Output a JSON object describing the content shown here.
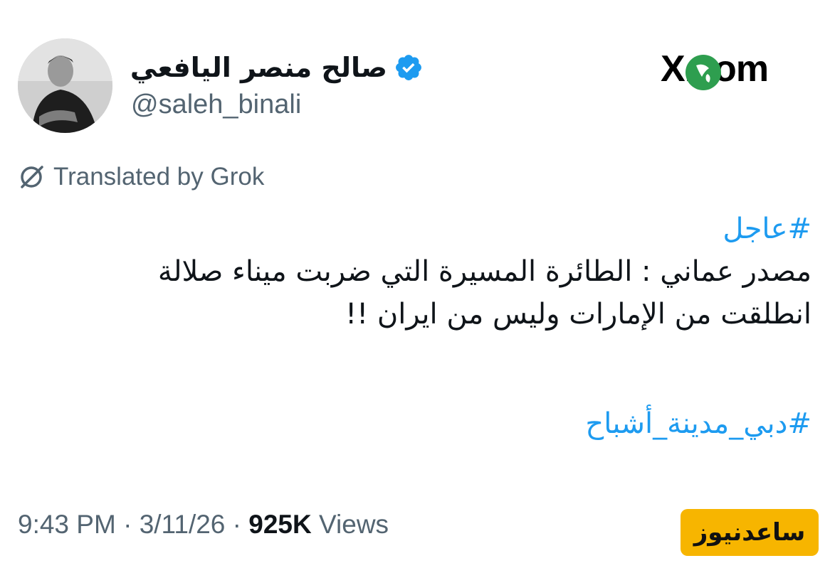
{
  "author": {
    "display_name": "صالح منصر اليافعي",
    "handle": "@saleh_binali",
    "verified": true
  },
  "brand": {
    "logo_text": "X.com",
    "badge_color": "#2e9e4f"
  },
  "translation": {
    "label": "Translated by Grok",
    "icon": "translate-icon"
  },
  "tweet": {
    "hashtag_1": "#عاجل",
    "line_1": "مصدر عماني : الطائرة المسيرة التي ضربت ميناء صلالة",
    "line_2": "انطلقت من الإمارات وليس من ايران  !!",
    "hashtag_2": "#دبي_مدينة_أشباح"
  },
  "meta": {
    "time": "9:43 PM",
    "separator": " · ",
    "date": "3/11/26",
    "views_count": "925K",
    "views_label": " Views"
  },
  "watermark": {
    "text": "ساعدنیوز",
    "color": "#f7b500"
  },
  "colors": {
    "link": "#1d9bf0",
    "secondary_text": "#536471",
    "primary_text": "#0f1419",
    "verified": "#1d9bf0"
  }
}
